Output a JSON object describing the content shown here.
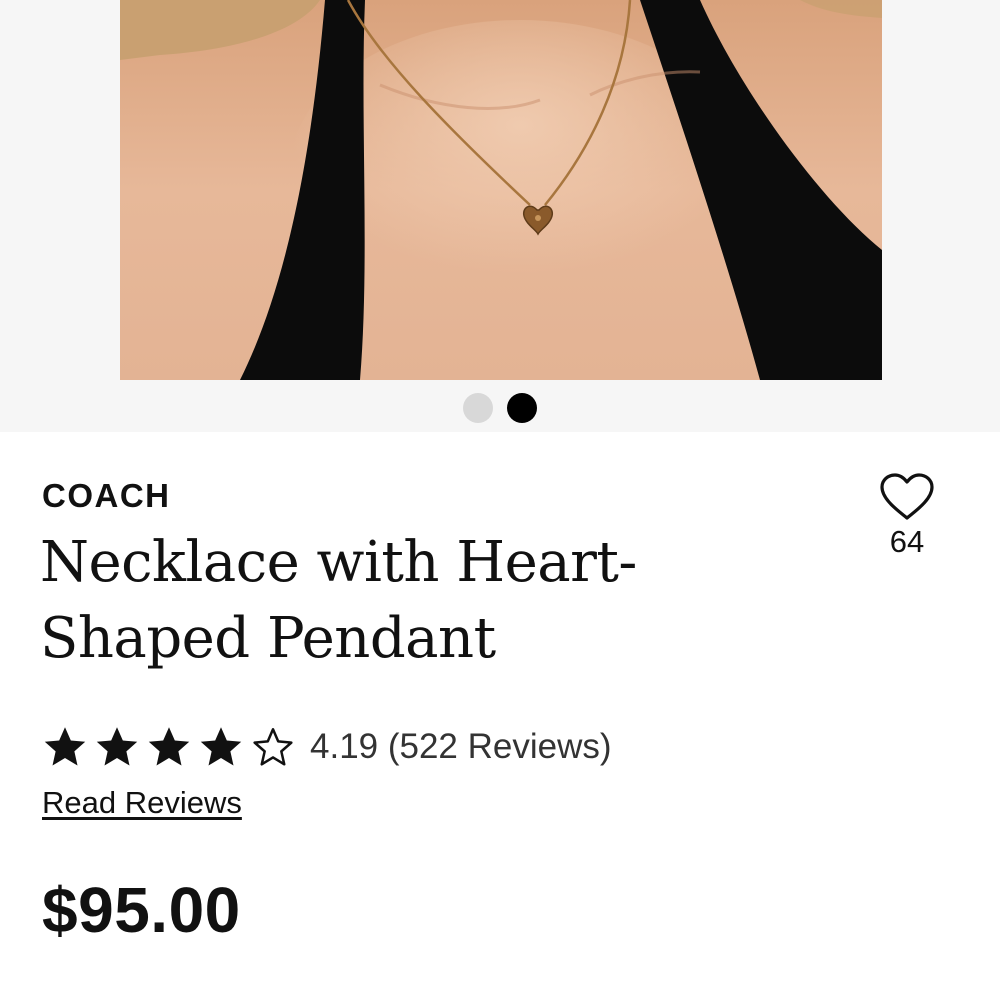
{
  "gallery": {
    "image_alt": "Model wearing gold heart pendant necklace with black halter top",
    "slide_count": 2,
    "active_slide": 2
  },
  "product": {
    "brand": "COACH",
    "title": "Necklace with Heart-Shaped Pendant",
    "price": "$95.00"
  },
  "favorites": {
    "count": "64",
    "icon": "heart-outline-icon"
  },
  "rating": {
    "value": 4.19,
    "max": 5,
    "text": "4.19 (522 Reviews)",
    "read_reviews_label": "Read Reviews",
    "filled_stars": 4,
    "icons": [
      "star-filled-icon",
      "star-outline-icon"
    ]
  },
  "colors": {
    "text": "#111111",
    "dot_inactive": "#d8d8d8",
    "dot_active": "#000000",
    "gallery_bg": "#f6f6f6"
  }
}
